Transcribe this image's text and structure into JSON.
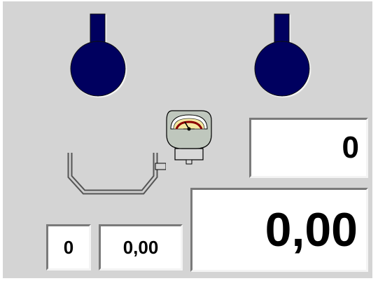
{
  "colors": {
    "panel_bg": "#d4d4d4",
    "flask_fill": "#03065e",
    "field_bg": "#ffffff",
    "gauge_face": "#f4e8a0",
    "gauge_needle": "#8b0000"
  },
  "icons": {
    "flask_left": "round-bottom-flask-icon",
    "flask_right": "round-bottom-flask-icon",
    "balance": "balance-pan-icon",
    "gauge": "pressure-gauge-icon"
  },
  "readouts": {
    "main_count": "0",
    "main_value": "0,00",
    "small_count": "0",
    "small_value": "0,00"
  }
}
